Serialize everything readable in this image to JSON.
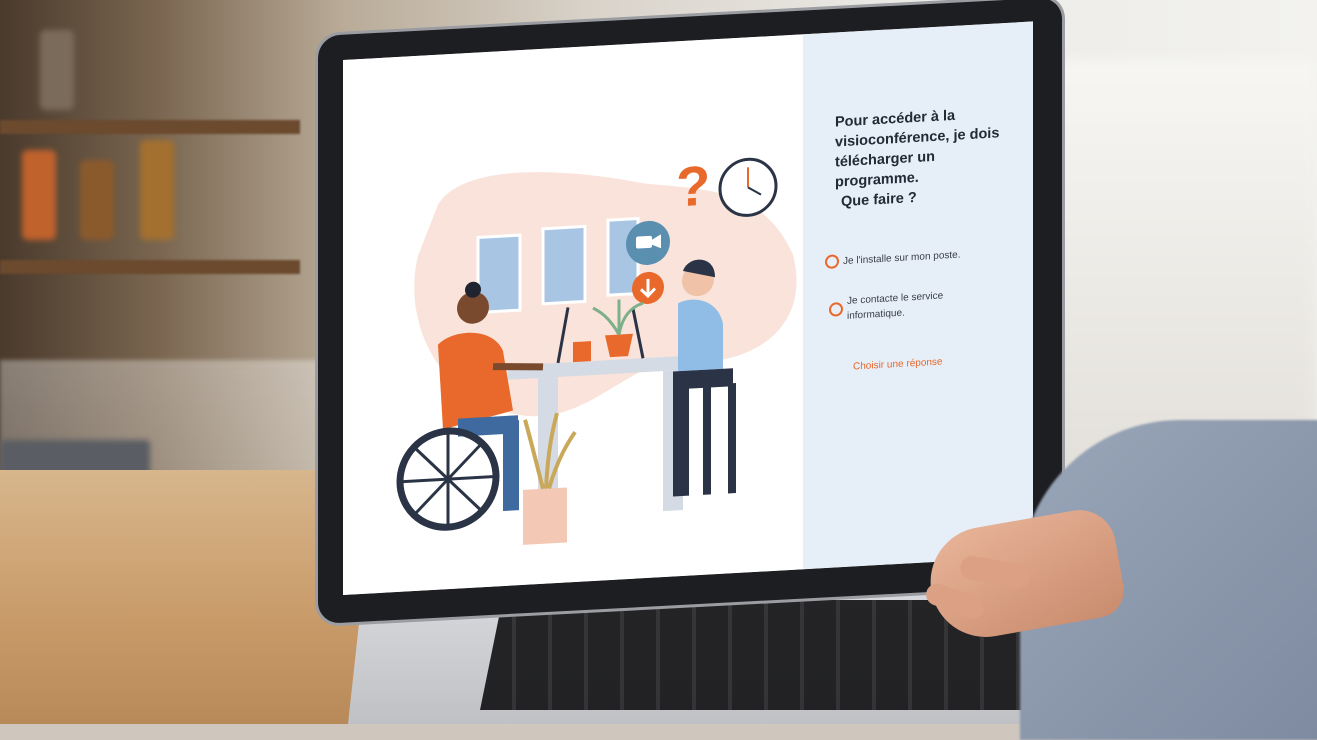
{
  "quiz": {
    "question_lines": [
      "Pour accéder à la",
      "visioconférence, je dois",
      "télécharger un",
      "programme.",
      "Que faire ?"
    ],
    "options": [
      {
        "lines": [
          "Je l'installe sur mon poste."
        ]
      },
      {
        "lines": [
          "Je contacte le service",
          "informatique."
        ]
      }
    ],
    "submit_label": "Choisir une réponse"
  },
  "illustration": {
    "question_mark": "?"
  },
  "colors": {
    "accent": "#e8692b",
    "right_panel": "#e6eef8",
    "question_text": "#222a36"
  }
}
